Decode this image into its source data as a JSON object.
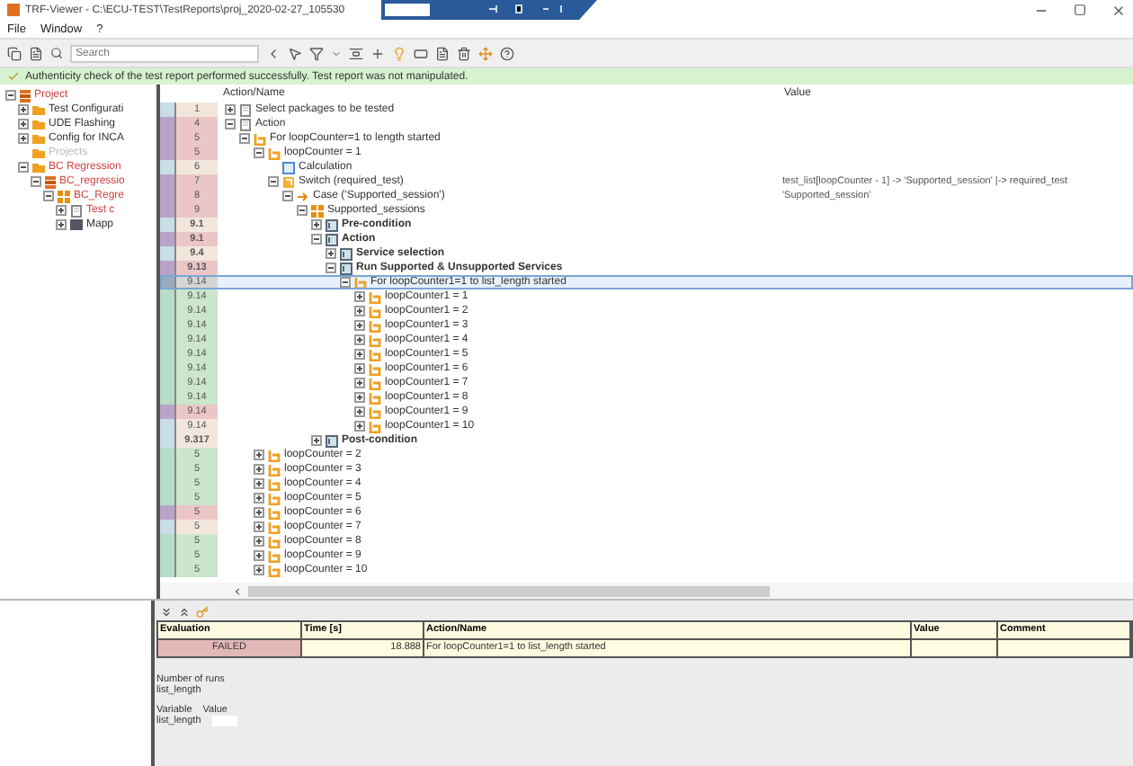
{
  "window": {
    "title": "TRF-Viewer - C:\\ECU-TEST\\TestReports\\proj_2020-02-27_105530"
  },
  "menu": [
    "File",
    "Window",
    "?"
  ],
  "search": {
    "placeholder": "Search"
  },
  "message": "Authenticity check of the test report performed successfully. Test report was not manipulated.",
  "project_tree": [
    {
      "label": "Project",
      "failed": true,
      "disabled": false,
      "kind": "project",
      "expanded": true,
      "children": [
        {
          "label": "Test Configurati",
          "failed": false,
          "disabled": false,
          "kind": "folder",
          "expanded": false
        },
        {
          "label": "UDE Flashing",
          "failed": false,
          "disabled": false,
          "kind": "folder",
          "expanded": false
        },
        {
          "label": "Config for INCA",
          "failed": false,
          "disabled": false,
          "kind": "folder",
          "expanded": false
        },
        {
          "label": "Projects",
          "failed": false,
          "disabled": true,
          "kind": "folder"
        },
        {
          "label": "BC Regression",
          "failed": true,
          "disabled": false,
          "kind": "folder",
          "expanded": true,
          "children": [
            {
              "label": "BC_regressio",
              "failed": true,
              "disabled": false,
              "kind": "project",
              "expanded": true,
              "children": [
                {
                  "label": "BC_Regre",
                  "failed": true,
                  "disabled": false,
                  "kind": "grid",
                  "expanded": true,
                  "children": [
                    {
                      "label": "Test c",
                      "failed": true,
                      "disabled": false,
                      "kind": "package",
                      "expanded": false
                    },
                    {
                      "label": "Mapp",
                      "failed": false,
                      "disabled": false,
                      "kind": "mapping",
                      "expanded": false
                    }
                  ]
                }
              ]
            }
          ]
        }
      ]
    }
  ],
  "grid": {
    "columns": [
      "Action/Name",
      "Value"
    ],
    "rows": [
      {
        "number": "1",
        "label": "Select packages to be tested",
        "kind": "package",
        "bold": false,
        "color": "#f3e7dd",
        "selected": false,
        "expanded": false
      },
      {
        "number": "4",
        "label": "Action",
        "kind": "package",
        "bold": false,
        "color": "#ebc6c6",
        "selected": false,
        "expanded": true,
        "children": [
          {
            "number": "5",
            "label": "For loopCounter=1 to length started",
            "kind": "loop",
            "bold": false,
            "color": "#ebc6c6",
            "selected": false,
            "expanded": true,
            "children": [
              {
                "number": "5",
                "label": "loopCounter = 1",
                "kind": "loop",
                "bold": false,
                "color": "#ebc6c6",
                "selected": false,
                "expanded": true,
                "children": [
                  {
                    "number": "6",
                    "label": "Calculation",
                    "kind": "calc",
                    "bold": false,
                    "color": "#f3e7dd",
                    "selected": false
                  },
                  {
                    "number": "7",
                    "label": "Switch (required_test)",
                    "kind": "switch",
                    "bold": false,
                    "color": "#ebc6c6",
                    "selected": false,
                    "expanded": true,
                    "value": "test_list[loopCounter - 1] -> 'Supported_session' |-> required_test",
                    "children": [
                      {
                        "number": "8",
                        "label": "Case ('Supported_session')",
                        "kind": "case",
                        "bold": false,
                        "color": "#ebc6c6",
                        "selected": false,
                        "expanded": true,
                        "value": "'Supported_session'",
                        "children": [
                          {
                            "number": "9",
                            "label": "Supported_sessions",
                            "kind": "grid",
                            "bold": false,
                            "color": "#ebc6c6",
                            "selected": false,
                            "expanded": true,
                            "children": [
                              {
                                "number": "9.1",
                                "label": "Pre-condition",
                                "kind": "block",
                                "bold": true,
                                "color": "#f3e7dd",
                                "selected": false,
                                "expanded": false
                              },
                              {
                                "number": "9.1",
                                "label": "Action",
                                "kind": "block",
                                "bold": true,
                                "color": "#ebc6c6",
                                "selected": false,
                                "expanded": true,
                                "children": [
                                  {
                                    "number": "9.4",
                                    "label": "Service selection",
                                    "kind": "block",
                                    "bold": true,
                                    "color": "#f3e7dd",
                                    "selected": false,
                                    "expanded": false
                                  },
                                  {
                                    "number": "9.13",
                                    "label": "Run Supported & Unsupported Services",
                                    "kind": "block",
                                    "bold": true,
                                    "color": "#ebc6c6",
                                    "selected": false,
                                    "expanded": true,
                                    "children": [
                                      {
                                        "number": "9.14",
                                        "label": "For loopCounter1=1 to list_length started",
                                        "kind": "loop",
                                        "bold": false,
                                        "color": "#d5d5d5",
                                        "selected": true,
                                        "expanded": true,
                                        "children": [
                                          {
                                            "number": "9.14",
                                            "label": "loopCounter1 = 1",
                                            "kind": "loop",
                                            "bold": false,
                                            "color": "#cbe6cb",
                                            "selected": false,
                                            "expanded": false
                                          },
                                          {
                                            "number": "9.14",
                                            "label": "loopCounter1 = 2",
                                            "kind": "loop",
                                            "bold": false,
                                            "color": "#cbe6cb",
                                            "selected": false,
                                            "expanded": false
                                          },
                                          {
                                            "number": "9.14",
                                            "label": "loopCounter1 = 3",
                                            "kind": "loop",
                                            "bold": false,
                                            "color": "#cbe6cb",
                                            "selected": false,
                                            "expanded": false
                                          },
                                          {
                                            "number": "9.14",
                                            "label": "loopCounter1 = 4",
                                            "kind": "loop",
                                            "bold": false,
                                            "color": "#cbe6cb",
                                            "selected": false,
                                            "expanded": false
                                          },
                                          {
                                            "number": "9.14",
                                            "label": "loopCounter1 = 5",
                                            "kind": "loop",
                                            "bold": false,
                                            "color": "#cbe6cb",
                                            "selected": false,
                                            "expanded": false
                                          },
                                          {
                                            "number": "9.14",
                                            "label": "loopCounter1 = 6",
                                            "kind": "loop",
                                            "bold": false,
                                            "color": "#cbe6cb",
                                            "selected": false,
                                            "expanded": false
                                          },
                                          {
                                            "number": "9.14",
                                            "label": "loopCounter1 = 7",
                                            "kind": "loop",
                                            "bold": false,
                                            "color": "#cbe6cb",
                                            "selected": false,
                                            "expanded": false
                                          },
                                          {
                                            "number": "9.14",
                                            "label": "loopCounter1 = 8",
                                            "kind": "loop",
                                            "bold": false,
                                            "color": "#cbe6cb",
                                            "selected": false,
                                            "expanded": false
                                          },
                                          {
                                            "number": "9.14",
                                            "label": "loopCounter1 = 9",
                                            "kind": "loop",
                                            "bold": false,
                                            "color": "#ebc6c6",
                                            "selected": false,
                                            "expanded": false
                                          },
                                          {
                                            "number": "9.14",
                                            "label": "loopCounter1 = 10",
                                            "kind": "loop",
                                            "bold": false,
                                            "color": "#f3e7dd",
                                            "selected": false,
                                            "expanded": false
                                          }
                                        ]
                                      }
                                    ]
                                  }
                                ]
                              },
                              {
                                "number": "9.317",
                                "label": "Post-condition",
                                "kind": "block",
                                "bold": true,
                                "color": "#f3e7dd",
                                "selected": false,
                                "expanded": false
                              }
                            ]
                          }
                        ]
                      }
                    ]
                  }
                ]
              },
              {
                "number": "5",
                "label": "loopCounter = 2",
                "kind": "loop",
                "bold": false,
                "color": "#cbe6cb",
                "selected": false,
                "expanded": false
              },
              {
                "number": "5",
                "label": "loopCounter = 3",
                "kind": "loop",
                "bold": false,
                "color": "#cbe6cb",
                "selected": false,
                "expanded": false
              },
              {
                "number": "5",
                "label": "loopCounter = 4",
                "kind": "loop",
                "bold": false,
                "color": "#cbe6cb",
                "selected": false,
                "expanded": false
              },
              {
                "number": "5",
                "label": "loopCounter = 5",
                "kind": "loop",
                "bold": false,
                "color": "#cbe6cb",
                "selected": false,
                "expanded": false
              },
              {
                "number": "5",
                "label": "loopCounter = 6",
                "kind": "loop",
                "bold": false,
                "color": "#ebc6c6",
                "selected": false,
                "expanded": false
              },
              {
                "number": "5",
                "label": "loopCounter = 7",
                "kind": "loop",
                "bold": false,
                "color": "#f3e7dd",
                "selected": false,
                "expanded": false
              },
              {
                "number": "5",
                "label": "loopCounter = 8",
                "kind": "loop",
                "bold": false,
                "color": "#cbe6cb",
                "selected": false,
                "expanded": false
              },
              {
                "number": "5",
                "label": "loopCounter = 9",
                "kind": "loop",
                "bold": false,
                "color": "#cbe6cb",
                "selected": false,
                "expanded": false
              },
              {
                "number": "5",
                "label": "loopCounter = 10",
                "kind": "loop",
                "bold": false,
                "color": "#cbe6cb",
                "selected": false,
                "expanded": false
              }
            ]
          }
        ]
      }
    ]
  },
  "details": {
    "columns": [
      "Evaluation",
      "Time [s]",
      "Action/Name",
      "Value",
      "Comment"
    ],
    "row": {
      "evaluation": "FAILED",
      "time": "18.888",
      "action": "For loopCounter1=1 to list_length started"
    },
    "runs_label": "Number of runs",
    "runs_value": "list_length",
    "var_header": [
      "Variable",
      "Value"
    ],
    "var_name": "list_length"
  }
}
